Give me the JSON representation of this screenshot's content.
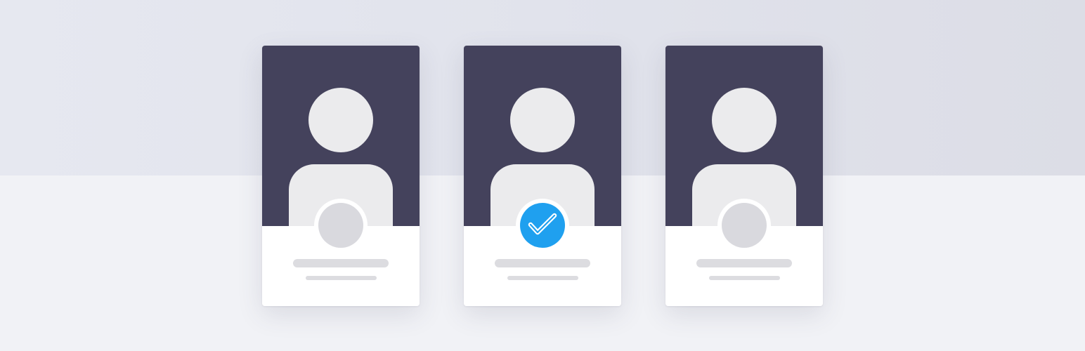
{
  "colors": {
    "background": "#f1f2f6",
    "card_header": "#44425c",
    "avatar_silhouette": "#ebebed",
    "badge_unselected": "#d9d9de",
    "badge_selected": "#1fa0ef",
    "placeholder_line": "#dcdce0"
  },
  "cards": [
    {
      "selected": false,
      "badge_icon": "empty-circle-icon"
    },
    {
      "selected": true,
      "badge_icon": "checkmark-icon"
    },
    {
      "selected": false,
      "badge_icon": "empty-circle-icon"
    }
  ]
}
